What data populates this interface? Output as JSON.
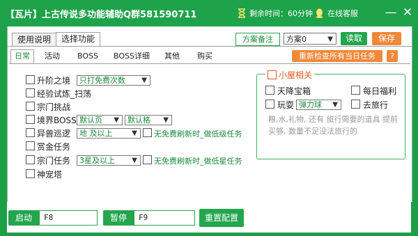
{
  "titlebar": {
    "title": "【瓦片】上古传说多功能辅助Q群581590711",
    "timer_label": "剩余时间：60分钟",
    "service": "在线客服",
    "minimize": "—",
    "close": "✕"
  },
  "outer_tabs": [
    "使用说明",
    "选择功能"
  ],
  "plan": {
    "note_button": "方案备注",
    "selected": "方案0",
    "read_button": "读取",
    "save_button": "保存"
  },
  "inner_tabs": [
    "日常",
    "活动",
    "BOSS",
    "BOSS详细",
    "其他",
    "购买"
  ],
  "recheck_button": "重新检查所有当日任务",
  "help_button": "?",
  "tasks": [
    {
      "label": "升阶之境",
      "select": "只打免费次数"
    },
    {
      "label": "经验试炼_扫荡"
    },
    {
      "label": "宗门挑战"
    },
    {
      "label": "境界BOSS",
      "select": "默认页",
      "select2": "默认格"
    },
    {
      "label": "异兽巡逻",
      "select": "地 及以上",
      "option": "无免费刷新时_做低级任务"
    },
    {
      "label": "赏金任务"
    },
    {
      "label": "宗门任务",
      "select": "3星及以上",
      "option": "无免费刷新时_做低星任务"
    },
    {
      "label": "神宠塔"
    }
  ],
  "hut": {
    "title": "小屋相关",
    "items": [
      "天降宝箱",
      "每日福利",
      "玩耍",
      "去旅行"
    ],
    "play_select": "弹力球",
    "note": "粮,水,礼物, 还有 旅行需要的道具 提前买够, 数量不足没法旅行的"
  },
  "bottom": {
    "start_label": "启动",
    "start_key": "F8",
    "pause_label": "暂停",
    "pause_key": "F9",
    "reset_button": "重置配置"
  }
}
